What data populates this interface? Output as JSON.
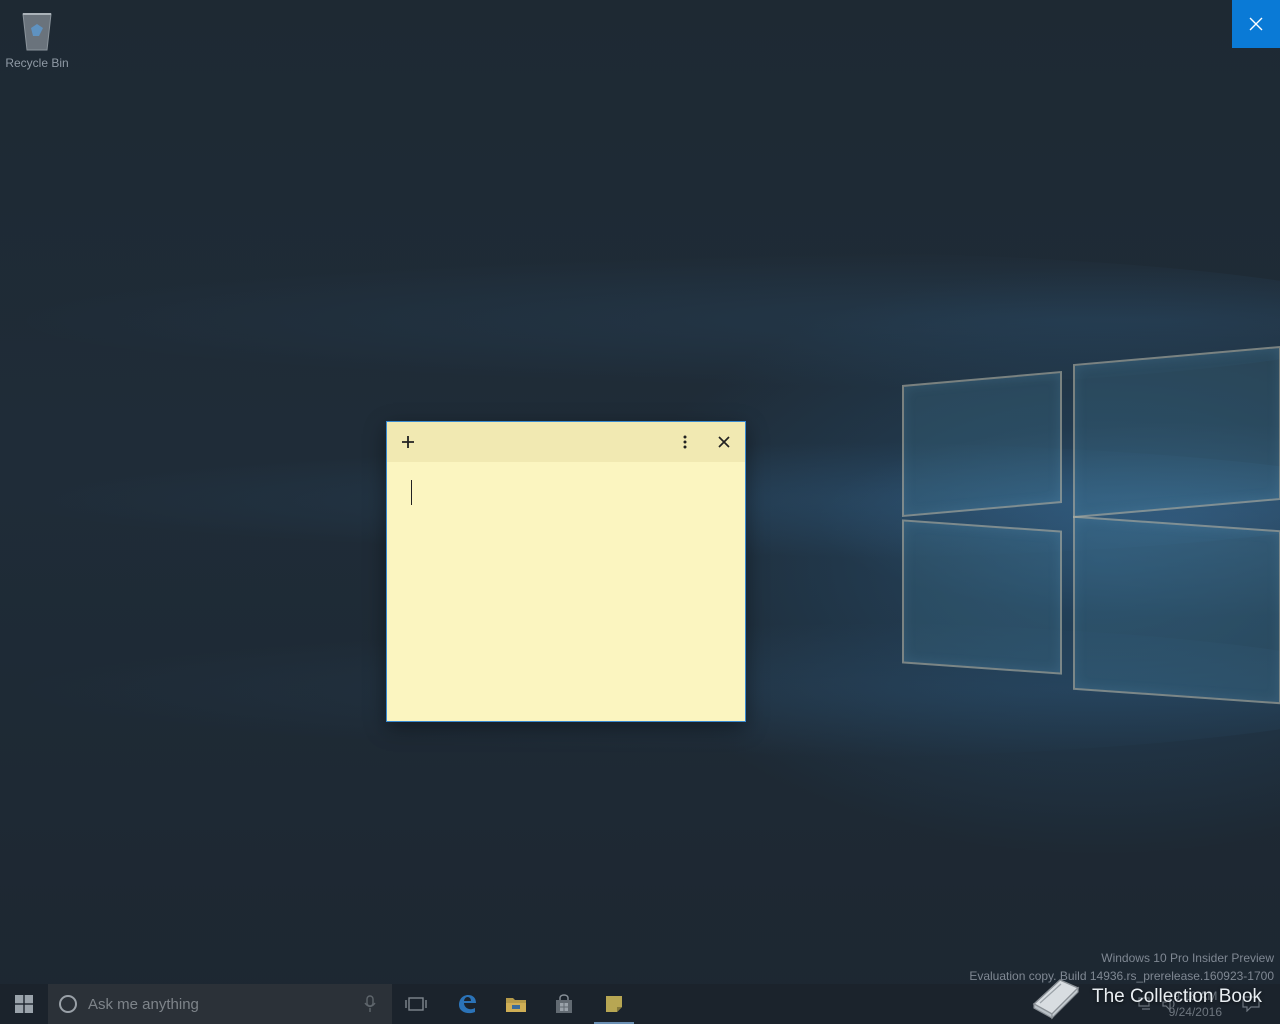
{
  "desktop": {
    "icons": [
      {
        "label": "Recycle Bin",
        "icon": "recycle-bin-icon"
      }
    ]
  },
  "overlay": {
    "close_icon": "close-icon",
    "accent": "#0a7ad6"
  },
  "sticky_note": {
    "add_icon": "plus-icon",
    "menu_icon": "more-vertical-icon",
    "close_icon": "close-icon",
    "text": "",
    "colors": {
      "header": "#f1e9b2",
      "body": "#fbf5c0",
      "border": "#3a8ad0"
    }
  },
  "watermark": {
    "line1": "Windows 10 Pro Insider Preview",
    "line2": "Evaluation copy. Build 14936.rs_prerelease.160923-1700"
  },
  "taskbar": {
    "start_icon": "windows-start-icon",
    "search": {
      "placeholder": "Ask me anything",
      "value": "",
      "mic_icon": "microphone-icon",
      "cortana_icon": "cortana-circle-icon"
    },
    "pinned": [
      {
        "name": "task-view",
        "icon": "task-view-icon"
      },
      {
        "name": "edge",
        "icon": "edge-browser-icon"
      },
      {
        "name": "file-explorer",
        "icon": "folder-icon"
      },
      {
        "name": "store",
        "icon": "store-bag-icon"
      },
      {
        "name": "sticky-notes",
        "icon": "sticky-notes-icon",
        "active": true
      }
    ],
    "tray": {
      "time": "9:18 AM",
      "date": "9/24/2016"
    }
  },
  "branding": {
    "text": "The Collection Book",
    "icon": "book-icon"
  }
}
